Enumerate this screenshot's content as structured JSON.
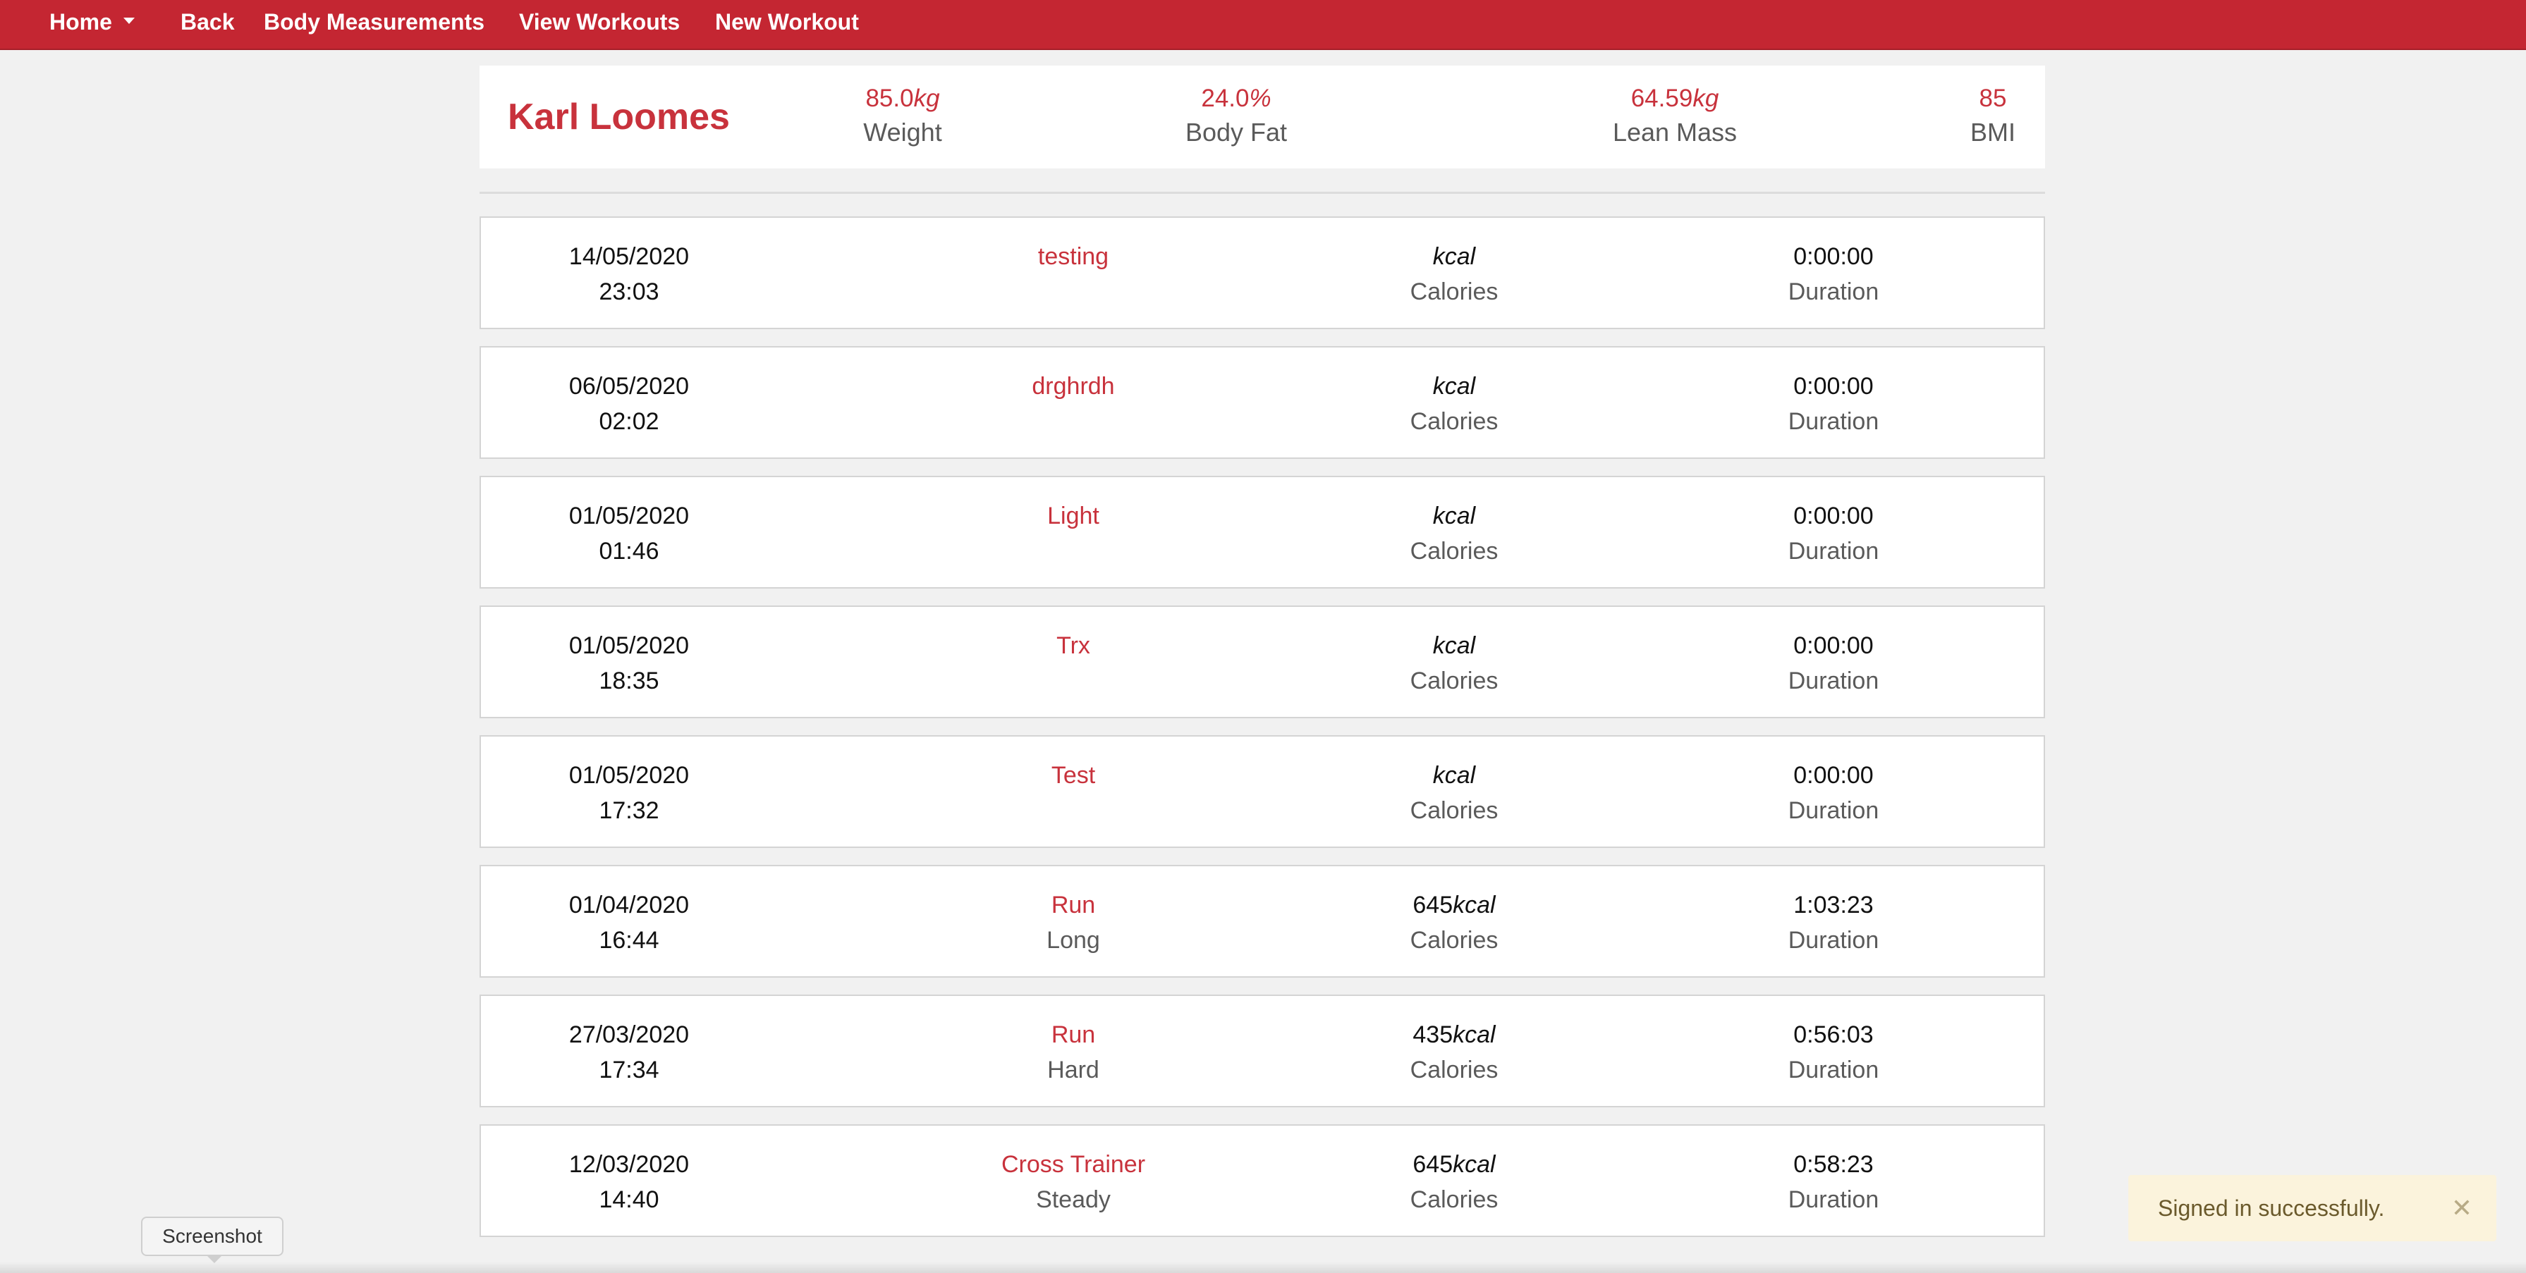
{
  "nav": {
    "home": "Home",
    "back": "Back",
    "body_measurements": "Body Measurements",
    "view_workouts": "View Workouts",
    "new_workout": "New Workout"
  },
  "profile": {
    "name": "Karl Loomes",
    "weight": {
      "value": "85.0",
      "unit": "kg",
      "label": "Weight"
    },
    "body_fat": {
      "value": "24.0",
      "unit": "%",
      "label": "Body Fat"
    },
    "lean_mass": {
      "value": "64.59",
      "unit": "kg",
      "label": "Lean Mass"
    },
    "bmi": {
      "value": "85",
      "label": "BMI"
    }
  },
  "workouts": [
    {
      "date": "14/05/2020",
      "time": "23:03",
      "name": "testing",
      "type": "",
      "calories": "",
      "cal_unit": "kcal",
      "cal_label": "Calories",
      "duration": "0:00:00",
      "dur_label": "Duration"
    },
    {
      "date": "06/05/2020",
      "time": "02:02",
      "name": "drghrdh",
      "type": "",
      "calories": "",
      "cal_unit": "kcal",
      "cal_label": "Calories",
      "duration": "0:00:00",
      "dur_label": "Duration"
    },
    {
      "date": "01/05/2020",
      "time": "01:46",
      "name": "Light",
      "type": "",
      "calories": "",
      "cal_unit": "kcal",
      "cal_label": "Calories",
      "duration": "0:00:00",
      "dur_label": "Duration"
    },
    {
      "date": "01/05/2020",
      "time": "18:35",
      "name": "Trx",
      "type": "",
      "calories": "",
      "cal_unit": "kcal",
      "cal_label": "Calories",
      "duration": "0:00:00",
      "dur_label": "Duration"
    },
    {
      "date": "01/05/2020",
      "time": "17:32",
      "name": "Test",
      "type": "",
      "calories": "",
      "cal_unit": "kcal",
      "cal_label": "Calories",
      "duration": "0:00:00",
      "dur_label": "Duration"
    },
    {
      "date": "01/04/2020",
      "time": "16:44",
      "name": "Run",
      "type": "Long",
      "calories": "645",
      "cal_unit": "kcal",
      "cal_label": "Calories",
      "duration": "1:03:23",
      "dur_label": "Duration"
    },
    {
      "date": "27/03/2020",
      "time": "17:34",
      "name": "Run",
      "type": "Hard",
      "calories": "435",
      "cal_unit": "kcal",
      "cal_label": "Calories",
      "duration": "0:56:03",
      "dur_label": "Duration"
    },
    {
      "date": "12/03/2020",
      "time": "14:40",
      "name": "Cross Trainer",
      "type": "Steady",
      "calories": "645",
      "cal_unit": "kcal",
      "cal_label": "Calories",
      "duration": "0:58:23",
      "dur_label": "Duration"
    }
  ],
  "toast": {
    "message": "Signed in successfully.",
    "close_icon": "close-icon"
  },
  "tooltip": {
    "label": "Screenshot"
  }
}
